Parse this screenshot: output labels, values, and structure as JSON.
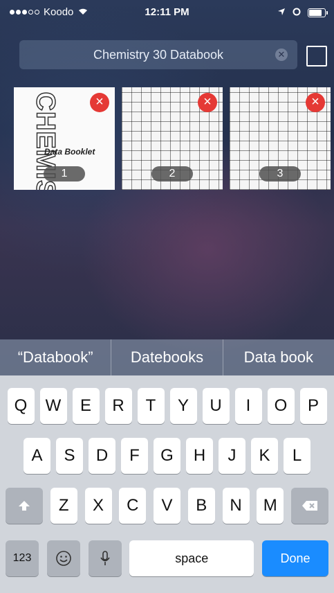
{
  "status_bar": {
    "carrier": "Koodo",
    "time": "12:11 PM"
  },
  "search": {
    "value": "Chemistry 30 Databook"
  },
  "thumbnails": [
    {
      "page": "1",
      "title": "CHEMISTRY",
      "subtitle": "Data Booklet"
    },
    {
      "page": "2"
    },
    {
      "page": "3"
    }
  ],
  "suggestions": [
    "“Databook”",
    "Datebooks",
    "Data book"
  ],
  "keyboard": {
    "row1": [
      "Q",
      "W",
      "E",
      "R",
      "T",
      "Y",
      "U",
      "I",
      "O",
      "P"
    ],
    "row2": [
      "A",
      "S",
      "D",
      "F",
      "G",
      "H",
      "J",
      "K",
      "L"
    ],
    "row3": [
      "Z",
      "X",
      "C",
      "V",
      "B",
      "N",
      "M"
    ],
    "numbers_label": "123",
    "space_label": "space",
    "done_label": "Done"
  }
}
